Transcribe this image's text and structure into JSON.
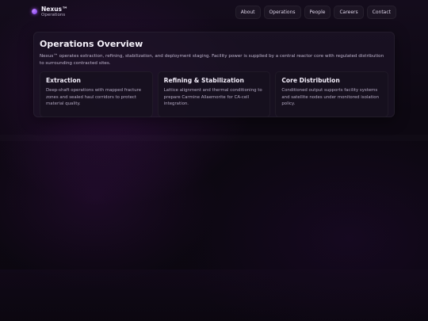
{
  "brand": {
    "name": "Nexus™",
    "subtitle": "Operations"
  },
  "nav": {
    "items": [
      {
        "label": "About"
      },
      {
        "label": "Operations"
      },
      {
        "label": "People"
      },
      {
        "label": "Careers"
      },
      {
        "label": "Contact"
      }
    ]
  },
  "overview": {
    "title": "Operations Overview",
    "description": "Nexus™ operates extraction, refining, stabilization, and deployment staging. Facility power is supplied by a central reactor core with regulated distribution to surrounding contracted sites.",
    "cards": [
      {
        "title": "Extraction",
        "body": "Deep-shaft operations with mapped fracture zones and sealed haul corridors to protect material quality."
      },
      {
        "title": "Refining & Stabilization",
        "body": "Lattice alignment and thermal conditioning to prepare Carmine Allaemorite for CA-cell integration."
      },
      {
        "title": "Core Distribution",
        "body": "Conditioned output supports facility systems and satellite nodes under monitored isolation policy."
      }
    ]
  },
  "colors": {
    "accent": "#a855f7",
    "background": "#0d0812",
    "panel": "#1c1426"
  }
}
